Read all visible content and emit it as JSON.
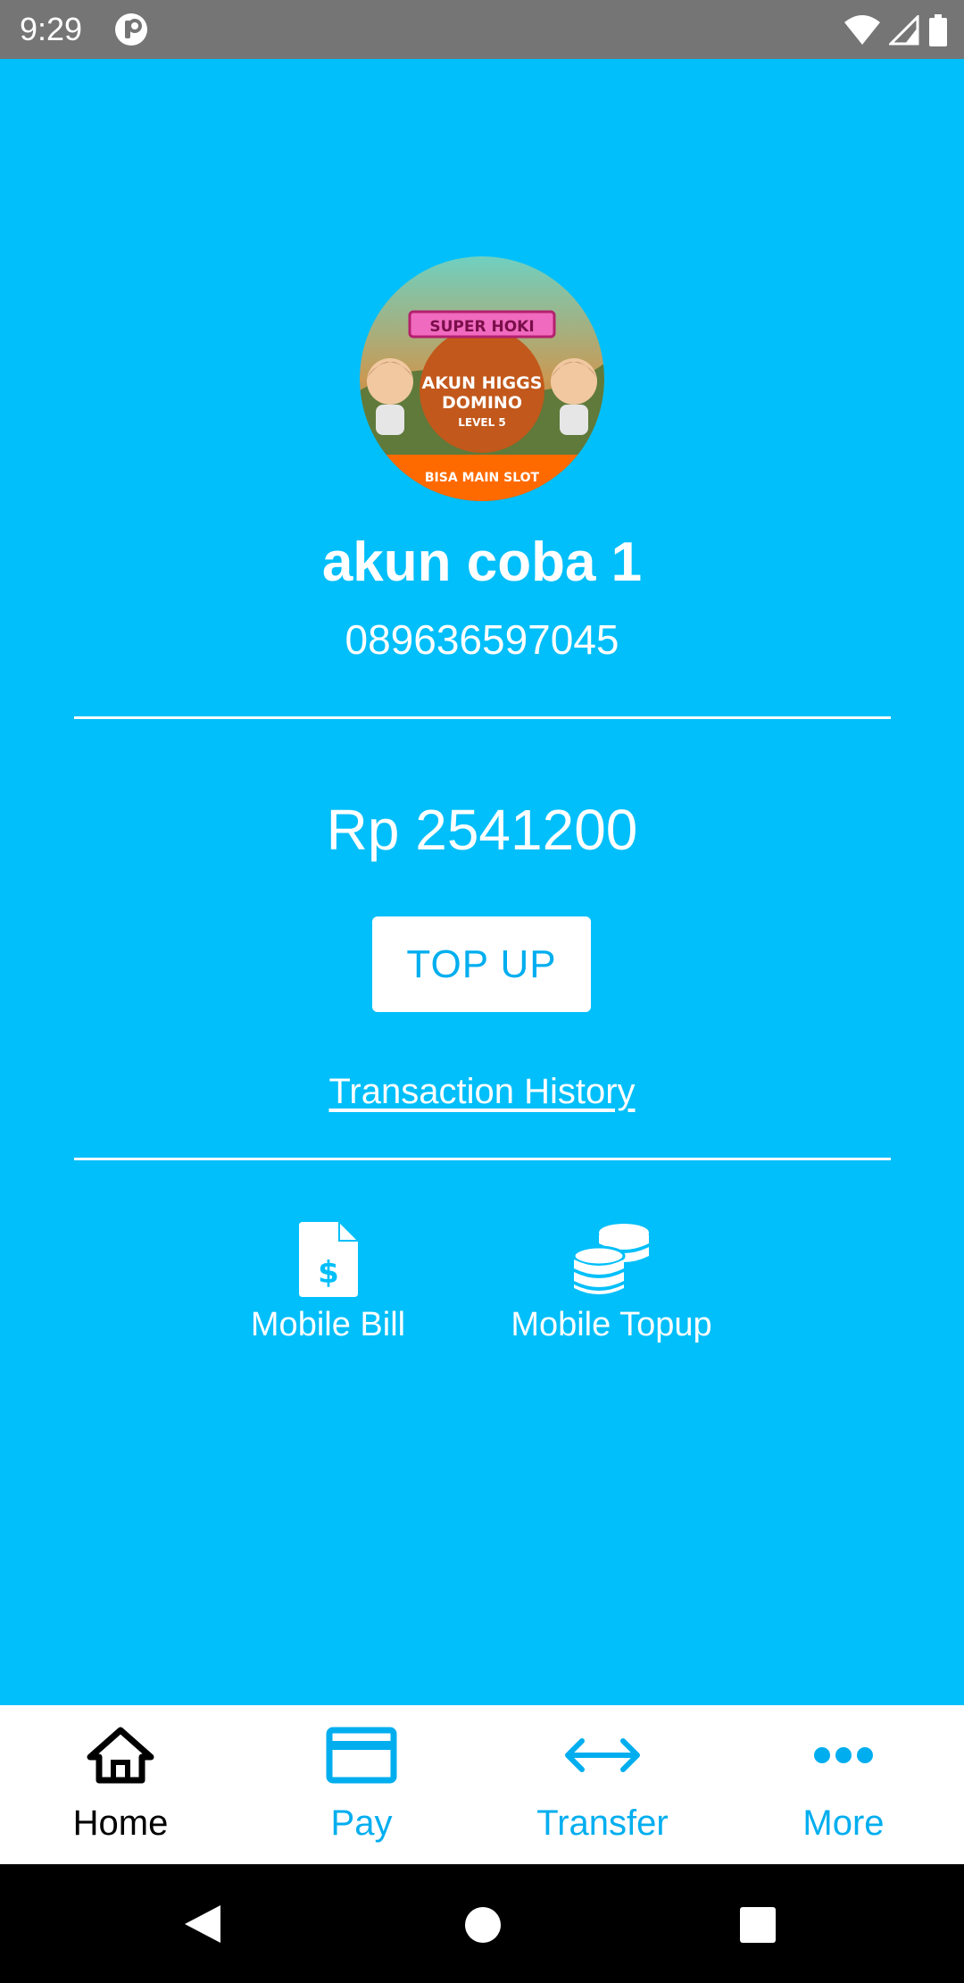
{
  "status_bar": {
    "time": "9:29"
  },
  "profile": {
    "avatar": {
      "banner": "SUPER HOKI",
      "title_line1": "AKUN HIGGS",
      "title_line2": "DOMINO",
      "level": "LEVEL 5",
      "footer": "BISA MAIN SLOT"
    },
    "name": "akun coba 1",
    "phone": "089636597045"
  },
  "wallet": {
    "balance": "Rp 2541200",
    "topup_label": "TOP UP",
    "history_label": "Transaction History"
  },
  "features": [
    {
      "label": "Mobile Bill",
      "icon": "bill-icon"
    },
    {
      "label": "Mobile Topup",
      "icon": "coins-icon"
    }
  ],
  "bottom_nav": [
    {
      "label": "Home",
      "icon": "home-icon",
      "active": true
    },
    {
      "label": "Pay",
      "icon": "card-icon",
      "active": false
    },
    {
      "label": "Transfer",
      "icon": "arrows-icon",
      "active": false
    },
    {
      "label": "More",
      "icon": "more-icon",
      "active": false
    }
  ],
  "colors": {
    "background": "#00BFFA",
    "accent": "#00AEEF",
    "status_bar": "#757575"
  }
}
